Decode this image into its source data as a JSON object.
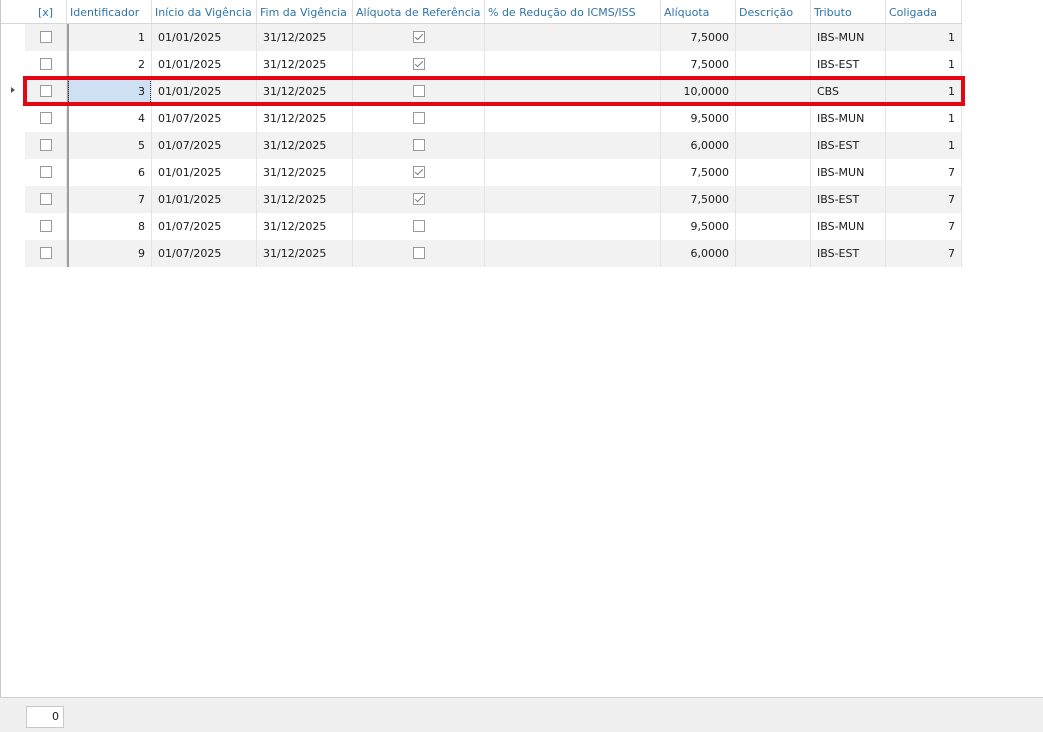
{
  "grid": {
    "columns": [
      {
        "label": "[x]"
      },
      {
        "label": "Identificador"
      },
      {
        "label": "Início da Vigência"
      },
      {
        "label": "Fim da Vigência"
      },
      {
        "label": "Alíquota de Referência"
      },
      {
        "label": "% de Redução do ICMS/ISS"
      },
      {
        "label": "Alíquota"
      },
      {
        "label": "Descrição"
      },
      {
        "label": "Tributo"
      },
      {
        "label": "Coligada"
      }
    ],
    "rows": [
      {
        "selected": false,
        "id": "1",
        "inicio": "01/01/2025",
        "fim": "31/12/2025",
        "referencia": true,
        "reducao": "",
        "aliquota": "7,5000",
        "descricao": "",
        "tributo": "IBS-MUN",
        "coligada": "1"
      },
      {
        "selected": false,
        "id": "2",
        "inicio": "01/01/2025",
        "fim": "31/12/2025",
        "referencia": true,
        "reducao": "",
        "aliquota": "7,5000",
        "descricao": "",
        "tributo": "IBS-EST",
        "coligada": "1"
      },
      {
        "selected": false,
        "id": "3",
        "inicio": "01/01/2025",
        "fim": "31/12/2025",
        "referencia": false,
        "reducao": "",
        "aliquota": "10,0000",
        "descricao": "",
        "tributo": "CBS",
        "coligada": "1"
      },
      {
        "selected": false,
        "id": "4",
        "inicio": "01/07/2025",
        "fim": "31/12/2025",
        "referencia": false,
        "reducao": "",
        "aliquota": "9,5000",
        "descricao": "",
        "tributo": "IBS-MUN",
        "coligada": "1"
      },
      {
        "selected": false,
        "id": "5",
        "inicio": "01/07/2025",
        "fim": "31/12/2025",
        "referencia": false,
        "reducao": "",
        "aliquota": "6,0000",
        "descricao": "",
        "tributo": "IBS-EST",
        "coligada": "1"
      },
      {
        "selected": false,
        "id": "6",
        "inicio": "01/01/2025",
        "fim": "31/12/2025",
        "referencia": true,
        "reducao": "",
        "aliquota": "7,5000",
        "descricao": "",
        "tributo": "IBS-MUN",
        "coligada": "7"
      },
      {
        "selected": false,
        "id": "7",
        "inicio": "01/01/2025",
        "fim": "31/12/2025",
        "referencia": true,
        "reducao": "",
        "aliquota": "7,5000",
        "descricao": "",
        "tributo": "IBS-EST",
        "coligada": "7"
      },
      {
        "selected": false,
        "id": "8",
        "inicio": "01/07/2025",
        "fim": "31/12/2025",
        "referencia": false,
        "reducao": "",
        "aliquota": "9,5000",
        "descricao": "",
        "tributo": "IBS-MUN",
        "coligada": "7"
      },
      {
        "selected": false,
        "id": "9",
        "inicio": "01/07/2025",
        "fim": "31/12/2025",
        "referencia": false,
        "reducao": "",
        "aliquota": "6,0000",
        "descricao": "",
        "tributo": "IBS-EST",
        "coligada": "7"
      }
    ],
    "focused_row": 3,
    "highlighted_row": 3,
    "highlight_color": "#e30613",
    "header_color": "#2f74a8"
  },
  "footer": {
    "selected_count": "0"
  }
}
